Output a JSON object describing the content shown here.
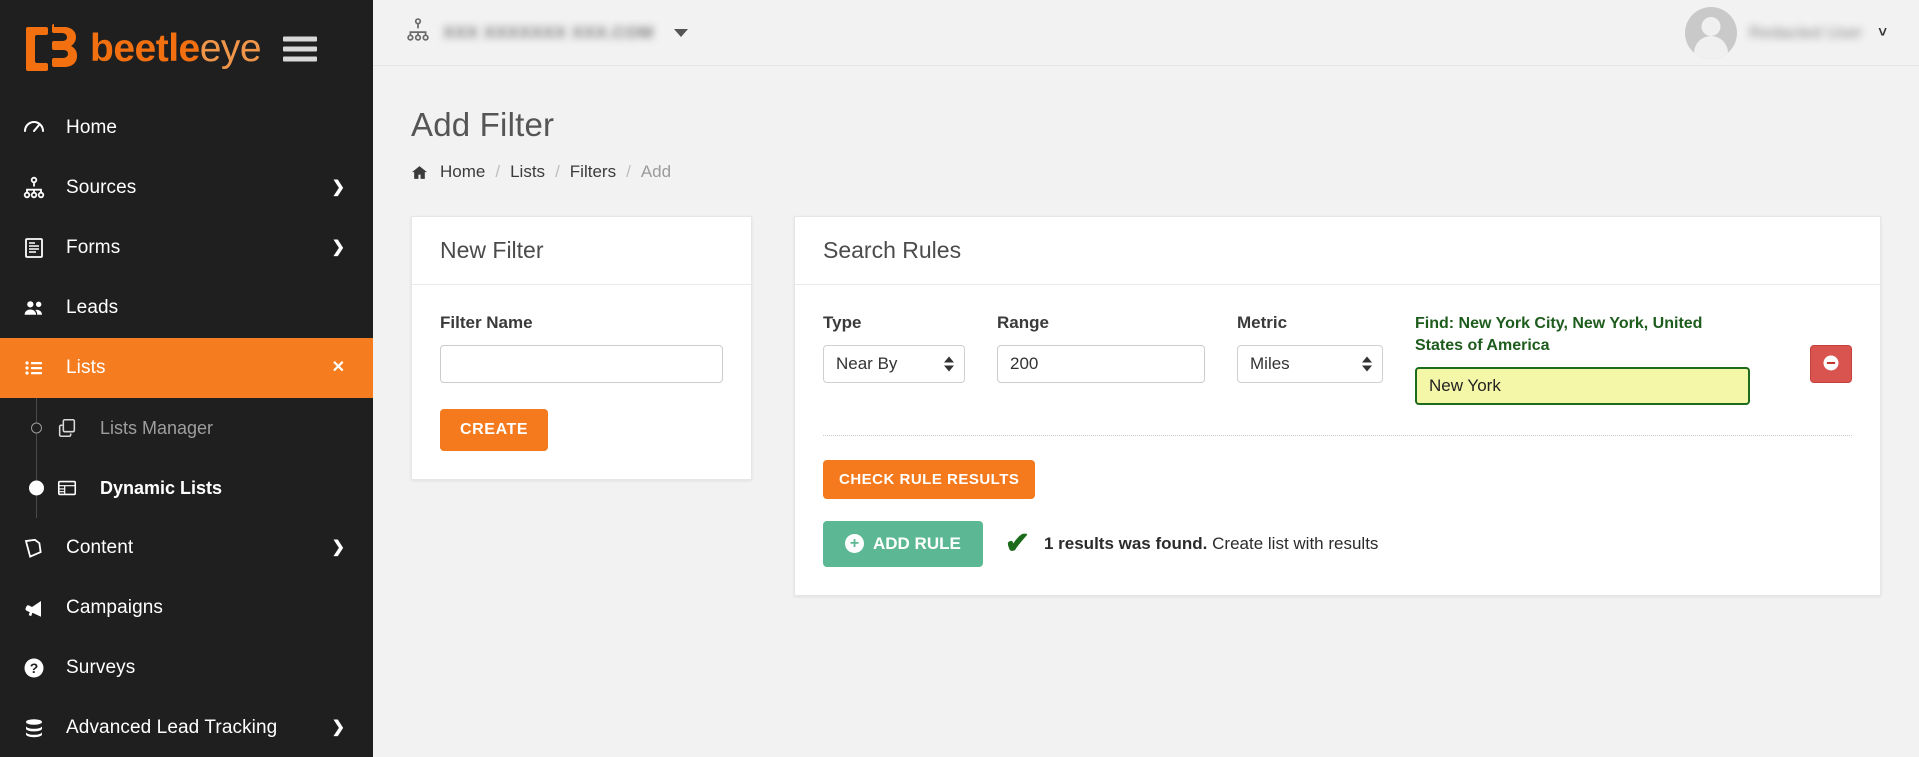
{
  "brand": {
    "part1": "beetle",
    "part2": "eye"
  },
  "sidebar": {
    "items": [
      {
        "label": "Home",
        "icon": "speedometer-icon",
        "caret": "",
        "active": false
      },
      {
        "label": "Sources",
        "icon": "sitemap-icon",
        "caret": "❯",
        "active": false
      },
      {
        "label": "Forms",
        "icon": "form-icon",
        "caret": "❯",
        "active": false
      },
      {
        "label": "Leads",
        "icon": "users-icon",
        "caret": "",
        "active": false
      },
      {
        "label": "Lists",
        "icon": "list-icon",
        "caret": "❯",
        "active": true
      }
    ],
    "submenu": [
      {
        "label": "Lists Manager",
        "icon": "copy-icon",
        "active": false
      },
      {
        "label": "Dynamic Lists",
        "icon": "table-icon",
        "active": true
      }
    ],
    "items_bottom": [
      {
        "label": "Content",
        "icon": "pages-icon",
        "caret": "❯"
      },
      {
        "label": "Campaigns",
        "icon": "megaphone-icon",
        "caret": ""
      },
      {
        "label": "Surveys",
        "icon": "question-circle-icon",
        "caret": ""
      },
      {
        "label": "Advanced Lead Tracking",
        "icon": "database-icon",
        "caret": "❯"
      }
    ]
  },
  "topbar": {
    "account_name": "XXX XXXXXXX XXX.COM",
    "user_name": "Redacted User"
  },
  "page": {
    "title": "Add Filter",
    "breadcrumb": [
      {
        "label": "Home",
        "muted": false
      },
      {
        "label": "Lists",
        "muted": false
      },
      {
        "label": "Filters",
        "muted": false
      },
      {
        "label": "Add",
        "muted": true
      }
    ]
  },
  "new_filter": {
    "heading": "New Filter",
    "name_label": "Filter Name",
    "name_value": "",
    "name_placeholder": "",
    "create_label": "CREATE"
  },
  "search_rules": {
    "heading": "Search Rules",
    "type_label": "Type",
    "type_value": "Near By",
    "range_label": "Range",
    "range_value": "200",
    "metric_label": "Metric",
    "metric_value": "Miles",
    "find_label": "Find: New York City, New York, United States of America",
    "find_value": "New York",
    "remove_icon": "minus-circle-icon",
    "check_label": "CHECK RULE RESULTS",
    "add_rule_label": "ADD RULE",
    "result_bold": "1 results was found.",
    "result_link": "Create list with results"
  },
  "colors": {
    "accent_orange": "#f47a1d",
    "sidebar_bg": "#1f1f1f",
    "green_btn": "#5cb894",
    "red_btn": "#d9534f",
    "find_green": "#1d5c1d",
    "find_yellow": "#f5f7a8"
  }
}
